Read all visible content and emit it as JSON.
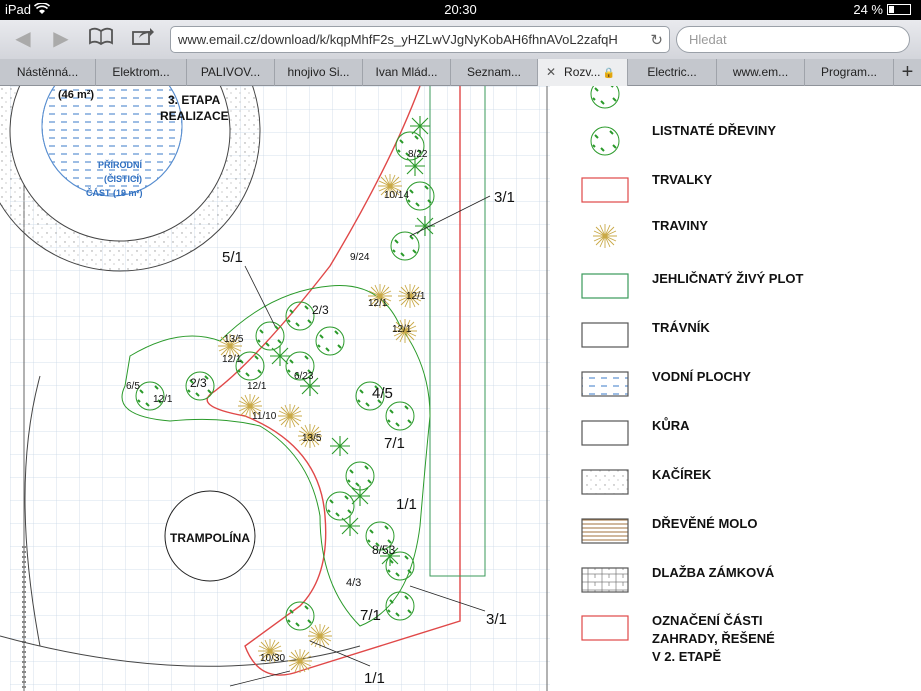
{
  "status": {
    "device": "iPad",
    "time": "20:30",
    "battery": "24 %"
  },
  "toolbar": {
    "url": "www.email.cz/download/k/kqpMhfF2s_yHZLwVJgNyKobAH6fhnAVoL2zafqH",
    "search_placeholder": "Hledat"
  },
  "tabs": [
    {
      "label": "Nástěnná..."
    },
    {
      "label": "Elektrom..."
    },
    {
      "label": "PALIVOV..."
    },
    {
      "label": "hnojivo Si..."
    },
    {
      "label": "Ivan Mlád..."
    },
    {
      "label": "Seznam..."
    },
    {
      "label": "Rozv..."
    },
    {
      "label": "Electric..."
    },
    {
      "label": "www.em..."
    },
    {
      "label": "Program..."
    }
  ],
  "plan": {
    "area_46": "(46 m²)",
    "etapa_line1": "3. ETAPA",
    "etapa_line2": "REALIZACE",
    "pond_line1": "PŘÍRODNÍ",
    "pond_line2": "(ČISTICÍ)",
    "pond_line3": "ČÁST (19 m²)",
    "trampolina": "TRAMPOLÍNA",
    "labels": [
      "8/22",
      "10/14",
      "3/1",
      "9/24",
      "5/1",
      "12/1",
      "2/3",
      "12/1",
      "12/1",
      "13/5",
      "12/1",
      "6/5",
      "2/3",
      "12/1",
      "6/23",
      "12/1",
      "4/5",
      "11/10",
      "13/5",
      "7/1",
      "1/1",
      "8/53",
      "4/3",
      "7/1",
      "3/1",
      "10/30",
      "1/1"
    ]
  },
  "legend": [
    {
      "label": "LISTNATÉ DŘEVINY",
      "symbol": "deciduous-tree"
    },
    {
      "label": "TRVALKY",
      "symbol": "red-box"
    },
    {
      "label": "TRAVINY",
      "symbol": "grass-star"
    },
    {
      "label": "JEHLIČNATÝ ŽIVÝ PLOT",
      "symbol": "green-box"
    },
    {
      "label": "TRÁVNÍK",
      "symbol": "grey-box"
    },
    {
      "label": "VODNÍ PLOCHY",
      "symbol": "water-box"
    },
    {
      "label": "KŮRA",
      "symbol": "plain-box"
    },
    {
      "label": "KAČÍREK",
      "symbol": "dotted-box"
    },
    {
      "label": "DŘEVĚNÉ MOLO",
      "symbol": "wood-box"
    },
    {
      "label": "DLAŽBA ZÁMKOVÁ",
      "symbol": "brick-box"
    },
    {
      "label": "OZNAČENÍ ČÁSTI",
      "symbol": "red-box"
    },
    {
      "label": "ZAHRADY, ŘEŠENÉ"
    },
    {
      "label": "V 2. ETAPĚ"
    }
  ]
}
